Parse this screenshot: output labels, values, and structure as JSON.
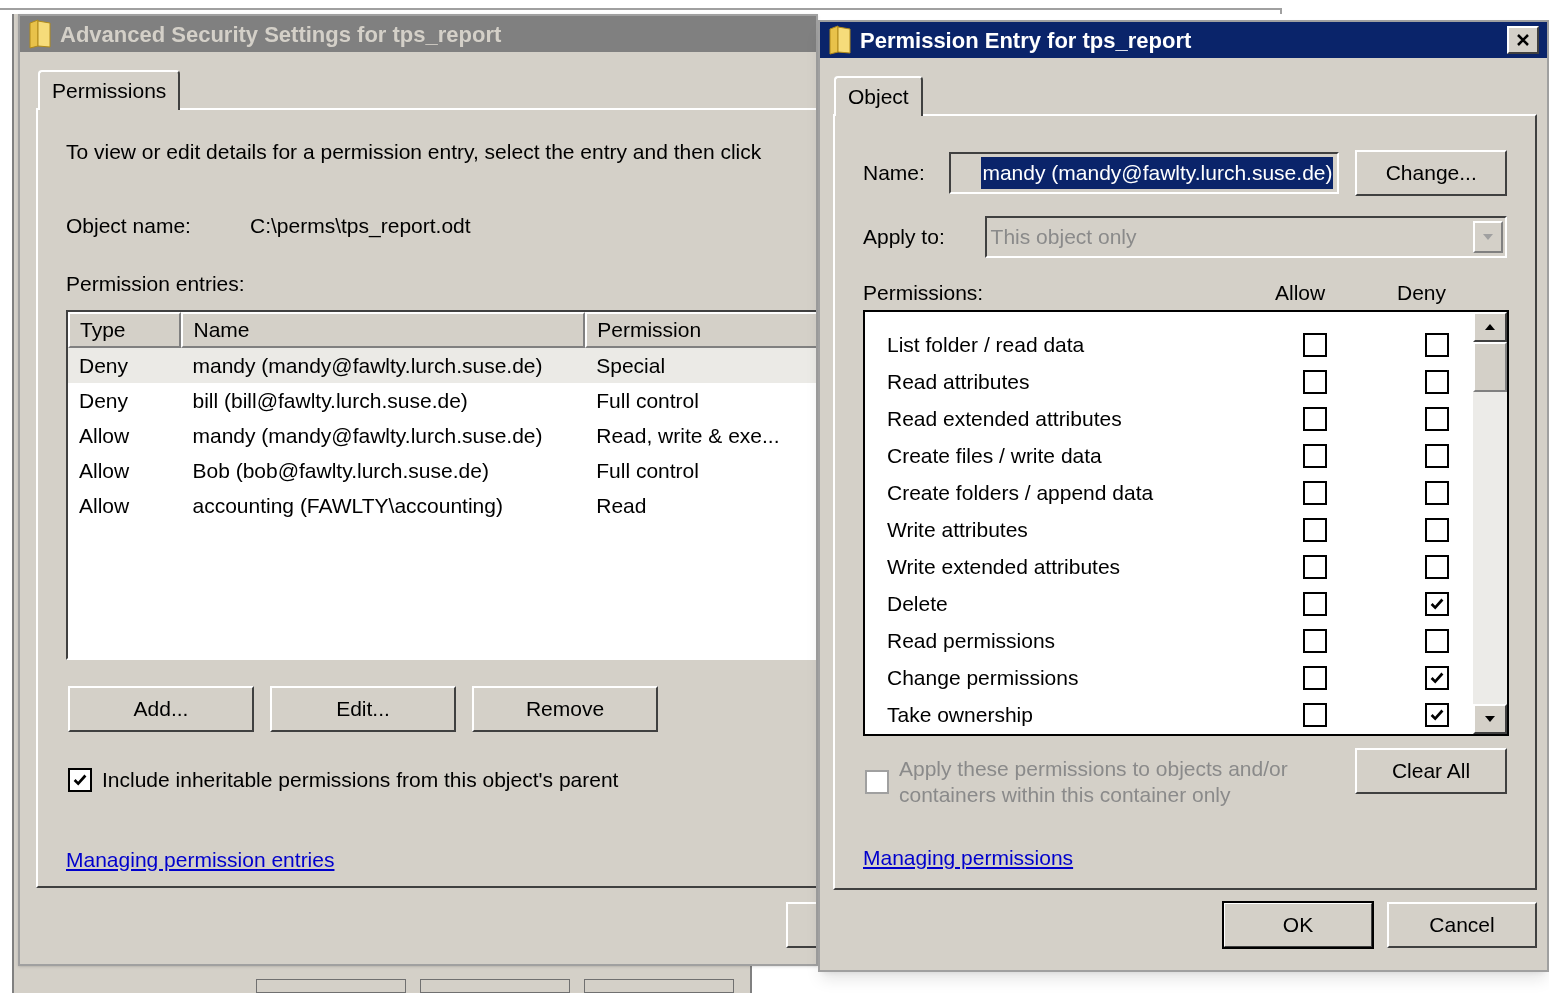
{
  "security_window": {
    "title": "Advanced Security Settings for tps_report",
    "active": false,
    "tabs": [
      {
        "label": "Permissions",
        "selected": true
      }
    ],
    "instructions": "To view or edit details for a permission entry, select the entry and then click",
    "object_name_label": "Object name:",
    "object_name": "C:\\perms\\tps_report.odt",
    "entries_label": "Permission entries:",
    "table": {
      "columns": [
        "Type",
        "Name",
        "Permission"
      ],
      "rows": [
        {
          "type": "Deny",
          "name": "mandy (mandy@fawlty.lurch.suse.de)",
          "permission": "Special",
          "selected": true
        },
        {
          "type": "Deny",
          "name": "bill (bill@fawlty.lurch.suse.de)",
          "permission": "Full control",
          "selected": false
        },
        {
          "type": "Allow",
          "name": "mandy (mandy@fawlty.lurch.suse.de)",
          "permission": "Read, write & exe...",
          "selected": false
        },
        {
          "type": "Allow",
          "name": "Bob (bob@fawlty.lurch.suse.de)",
          "permission": "Full control",
          "selected": false
        },
        {
          "type": "Allow",
          "name": "accounting (FAWLTY\\accounting)",
          "permission": "Read",
          "selected": false
        }
      ]
    },
    "buttons": [
      "Add...",
      "Edit...",
      "Remove"
    ],
    "inherit": {
      "label": "Include inheritable permissions from this object's parent",
      "checked": true
    },
    "link": "Managing permission entries"
  },
  "entry_window": {
    "title": "Permission Entry for tps_report",
    "active": true,
    "tabs": [
      {
        "label": "Object",
        "selected": true
      }
    ],
    "name_label": "Name:",
    "name_value": "mandy (mandy@fawlty.lurch.suse.de)",
    "change_button": "Change...",
    "apply_label": "Apply to:",
    "apply_value": "This object only",
    "apply_disabled": true,
    "permissions_label": "Permissions:",
    "columns": [
      "Allow",
      "Deny"
    ],
    "permissions": [
      {
        "name": "List folder / read data",
        "allow": false,
        "deny": false
      },
      {
        "name": "Read attributes",
        "allow": false,
        "deny": false
      },
      {
        "name": "Read extended attributes",
        "allow": false,
        "deny": false
      },
      {
        "name": "Create files / write data",
        "allow": false,
        "deny": false
      },
      {
        "name": "Create folders / append data",
        "allow": false,
        "deny": false
      },
      {
        "name": "Write attributes",
        "allow": false,
        "deny": false
      },
      {
        "name": "Write extended attributes",
        "allow": false,
        "deny": false
      },
      {
        "name": "Delete",
        "allow": false,
        "deny": true
      },
      {
        "name": "Read permissions",
        "allow": false,
        "deny": false
      },
      {
        "name": "Change permissions",
        "allow": false,
        "deny": true
      },
      {
        "name": "Take ownership",
        "allow": false,
        "deny": true
      }
    ],
    "apply_within": {
      "label": "Apply these permissions to objects and/or containers within this container only",
      "checked": false,
      "disabled": true
    },
    "clear_button": "Clear All",
    "link": "Managing permissions",
    "buttons": [
      {
        "label": "OK",
        "default": true
      },
      {
        "label": "Cancel",
        "default": false
      }
    ]
  }
}
